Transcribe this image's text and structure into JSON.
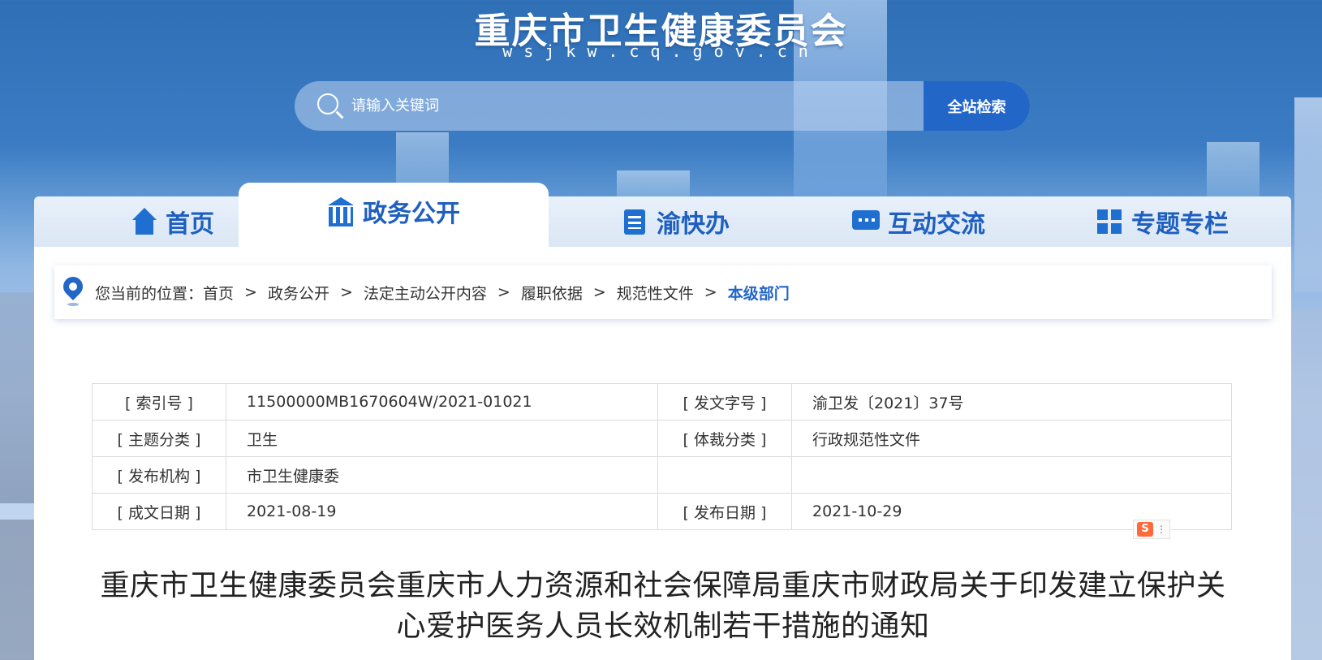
{
  "site": {
    "title": "重庆市卫生健康委员会",
    "domain": "wsjkw.cq.gov.cn"
  },
  "search": {
    "placeholder": "请输入关键词",
    "button_label": "全站检索"
  },
  "nav": {
    "tabs": [
      {
        "label": "首页",
        "icon": "home-icon"
      },
      {
        "label": "政务公开",
        "icon": "government-building-icon",
        "active": true
      },
      {
        "label": "渝快办",
        "icon": "clipboard-icon"
      },
      {
        "label": "互动交流",
        "icon": "chat-bubble-icon"
      },
      {
        "label": "专题专栏",
        "icon": "grid-icon"
      }
    ]
  },
  "breadcrumb": {
    "prefix": "您当前的位置：",
    "separator": ">",
    "items": [
      "首页",
      "政务公开",
      "法定主动公开内容",
      "履职依据",
      "规范性文件"
    ],
    "current": "本级部门"
  },
  "meta": {
    "index_no_label": "[ 索引号 ]",
    "index_no": "11500000MB1670604W/2021-01021",
    "doc_no_label": "[ 发文字号 ]",
    "doc_no": "渝卫发〔2021〕37号",
    "topic_label": "[ 主题分类 ]",
    "topic": "卫生",
    "genre_label": "[ 体裁分类 ]",
    "genre": "行政规范性文件",
    "issuer_label": "[ 发布机构 ]",
    "issuer": "市卫生健康委",
    "written_date_label": "[ 成文日期 ]",
    "written_date": "2021-08-19",
    "publish_date_label": "[ 发布日期 ]",
    "publish_date": "2021-10-29"
  },
  "ime_badge": {
    "label": "S"
  },
  "document": {
    "title_line1": "重庆市卫生健康委员会重庆市人力资源和社会保障局重庆市财政局关于印发建立保护关",
    "title_line2": "心爱护医务人员长效机制若干措施的通知"
  }
}
